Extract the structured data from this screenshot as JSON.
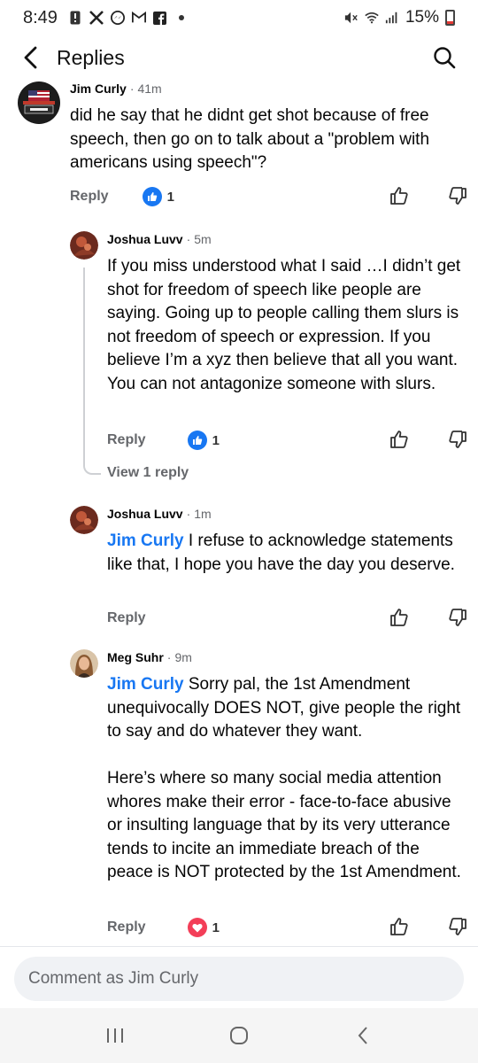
{
  "status": {
    "time": "8:49",
    "battery": "15%",
    "notification_icons": [
      "alert-icon",
      "x-icon",
      "messenger-icon",
      "gmail-icon",
      "facebook-icon",
      "dot-icon"
    ],
    "system_icons": [
      "mute-icon",
      "wifi-icon",
      "signal-icon",
      "battery-icon"
    ]
  },
  "header": {
    "title": "Replies"
  },
  "comments": [
    {
      "author": "Jim Curly",
      "time": "41m",
      "avatar_text": "THE UNCENSORED TRUTH",
      "mention": "",
      "text": "did he say that he didnt get shot because of free speech, then go on to talk about a \"problem with americans using speech\"?",
      "reply_label": "Reply",
      "reaction_type": "like",
      "reaction_count": "1"
    },
    {
      "author": "Joshua Luvv",
      "time": "5m",
      "mention": "",
      "text": "If you miss understood what I said …I didn’t get shot for freedom of speech like people are saying. Going up to people calling them slurs is not freedom of speech or expression. If you believe I’m a xyz then believe that all you want. You can not antagonize someone with slurs.",
      "reply_label": "Reply",
      "reaction_type": "like",
      "reaction_count": "1",
      "view_replies": "View 1 reply"
    },
    {
      "author": "Joshua Luvv",
      "time": "1m",
      "mention": "Jim Curly",
      "text": " I refuse to acknowledge statements like that, I hope you have the day you deserve.",
      "reply_label": "Reply"
    },
    {
      "author": "Meg Suhr",
      "time": "9m",
      "mention": "Jim Curly",
      "text": " Sorry pal, the 1st Amendment unequivocally DOES NOT, give people the right to say and do whatever they want.\n\nHere’s where so many social media attention whores make their error - face-to-face abusive or insulting language that by its very utterance tends to incite an immediate breach of the peace is NOT protected by the 1st Amendment.",
      "reply_label": "Reply",
      "reaction_type": "love",
      "reaction_count": "1"
    }
  ],
  "composer": {
    "placeholder": "Comment as Jim Curly"
  },
  "colors": {
    "accent": "#1877f2",
    "love": "#f33e58",
    "muted": "#65676b"
  }
}
